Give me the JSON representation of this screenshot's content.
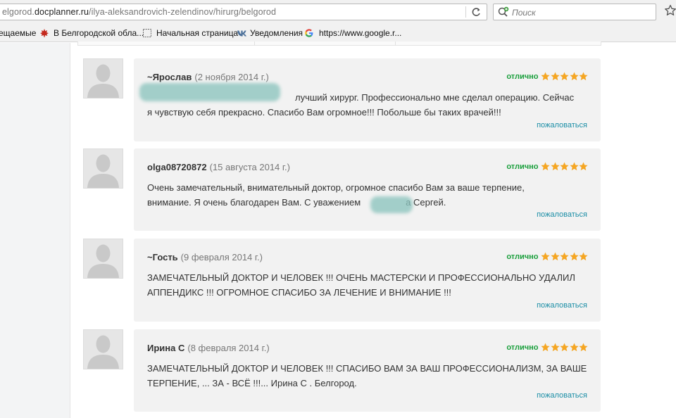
{
  "browser": {
    "url_prefix": "elgorod.",
    "url_host": "docplanner.ru",
    "url_path": "/ilya-aleksandrovich-zelendinov/hirurg/belgorod",
    "search_placeholder": "Поиск",
    "bookmarks": [
      {
        "label": "ещаемые"
      },
      {
        "label": "В Белгородской обла..."
      },
      {
        "label": "Начальная страница"
      },
      {
        "label": "Уведомления"
      },
      {
        "label": "https://www.google.r..."
      }
    ]
  },
  "reviews": [
    {
      "author": "~Ярослав",
      "date": "(2 ноября 2014 г.)",
      "rating_label": "отлично",
      "stars": 5,
      "line1": "лучший хирург. Профессионально мне сделал операцию. Сейчас",
      "line2": "я чувствую себя прекрасно. Спасибо Вам огромное!!! Побольше бы таких врачей!!!",
      "complain": "пожаловаться"
    },
    {
      "author": "olga08720872",
      "date": "(15 августа 2014 г.)",
      "rating_label": "отлично",
      "stars": 5,
      "line1": "Очень замечательный, внимательный доктор, огромное спасибо Вам за ваше терпение,",
      "line2a": "внимание. Я очень благодарен Вам. С уважением",
      "line2b": "а Сергей.",
      "complain": "пожаловаться"
    },
    {
      "author": "~Гость",
      "date": "(9 февраля 2014 г.)",
      "rating_label": "отлично",
      "stars": 5,
      "line1": "ЗАМЕЧАТЕЛЬНЫЙ ДОКТОР И ЧЕЛОВЕК !!! ОЧЕНЬ МАСТЕРСКИ И ПРОФЕССИОНАЛЬНО УДАЛИЛ",
      "line2": "АППЕНДИКС !!! ОГРОМНОЕ СПАСИБО ЗА ЛЕЧЕНИЕ И ВНИМАНИЕ !!!",
      "complain": "пожаловаться"
    },
    {
      "author": "Ирина С",
      "date": "(8 февраля 2014 г.)",
      "rating_label": "отлично",
      "stars": 5,
      "line1": "ЗАМЕЧАТЕЛЬНЫЙ ДОКТОР И ЧЕЛОВЕК !!! СПАСИБО ВАМ ЗА ВАШ ПРОФЕССИОНАЛИЗМ, ЗА ВАШЕ",
      "line2": "ТЕРПЕНИЕ, ... ЗА - ВСЁ !!!... Ирина С . Белгород.",
      "complain": "пожаловаться"
    }
  ],
  "colors": {
    "rating_green": "#1a9f3c",
    "star_orange": "#f5a623",
    "link_teal": "#1b8ea6",
    "card_bg": "#f2f2f2"
  },
  "icons": [
    "reload-icon",
    "search-engine-icon",
    "bookmark-star-icon",
    "vk-icon",
    "google-icon",
    "avatar-placeholder-icon",
    "rating-star-icon"
  ]
}
